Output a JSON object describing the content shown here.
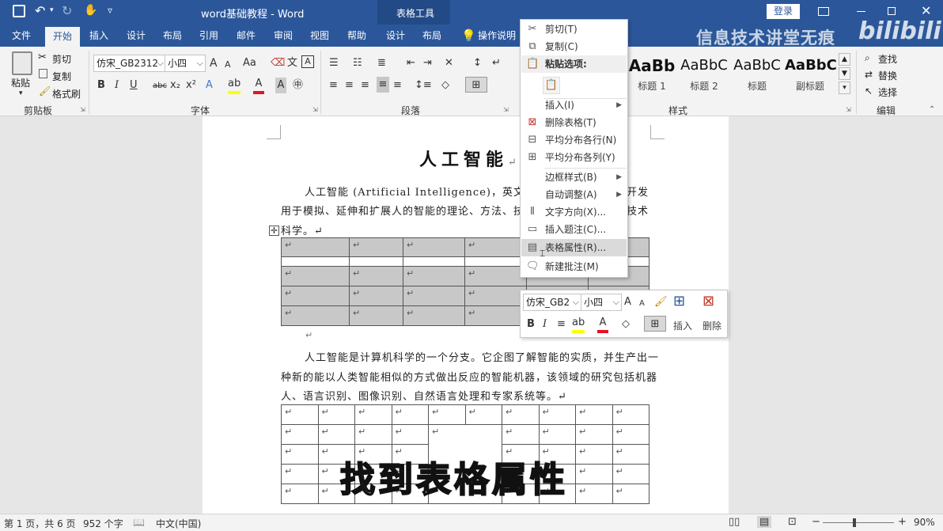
{
  "window": {
    "title": "word基础教程 - Word",
    "context_tools": "表格工具",
    "login": "登录",
    "quick_access_arrow": "▿"
  },
  "tabs": {
    "file": "文件",
    "home": "开始",
    "insert": "插入",
    "design": "设计",
    "layout": "布局",
    "references": "引用",
    "mailings": "邮件",
    "review": "审阅",
    "view": "视图",
    "help": "帮助",
    "table_design": "设计",
    "table_layout": "布局",
    "tell_me": "操作说明搜"
  },
  "clipboard": {
    "paste": "粘贴",
    "cut": "剪切",
    "copy": "复制",
    "format_painter": "格式刷",
    "group": "剪贴板"
  },
  "font": {
    "name": "仿宋_GB2312",
    "size": "小四",
    "group": "字体",
    "bold": "B",
    "italic": "I",
    "underline": "U",
    "strike": "abc",
    "sub": "x₂",
    "sup": "x²",
    "aa": "Aa",
    "grow": "A",
    "shrink": "A"
  },
  "paragraph": {
    "group": "段落"
  },
  "styles": {
    "group": "样式",
    "items": [
      {
        "preview": "AaBb",
        "name": "标题 1"
      },
      {
        "preview": "AaBbC",
        "name": "标题 2"
      },
      {
        "preview": "AaBbC",
        "name": "标题"
      },
      {
        "preview": "AaBbC",
        "name": "副标题"
      }
    ]
  },
  "editing": {
    "find": "查找",
    "replace": "替换",
    "select": "选择",
    "group": "编辑"
  },
  "watermark": {
    "channel": "信息技术讲堂无痕",
    "logo": "bilibili"
  },
  "document": {
    "title": "人工智能",
    "para1_line1": "人工智能 (Artificial Intelligence)，英文",
    "para1_line1_end": "开发",
    "para1_line2": "用于模拟、延伸和扩展人的智能的理论、方法、技术",
    "para1_line2_end": "技术",
    "para1_line3": "科学。↵",
    "para2_line1": "人工智能是计算机科学的一个分支。它企图了解智能的实质，并生产出一",
    "para2_line2": "种新的能以人类智能相似的方式做出反应的智能机器，该领域的研究包括机器",
    "para2_line3": "人、语言识别、图像识别、自然语言处理和专家系统等。↵",
    "cell_mark": "↵",
    "paragraph_mark": "↵"
  },
  "context_menu": {
    "cut": "剪切(T)",
    "copy": "复制(C)",
    "paste_options": "粘贴选项:",
    "insert": "插入(I)",
    "delete_table": "删除表格(T)",
    "distribute_rows": "平均分布各行(N)",
    "distribute_cols": "平均分布各列(Y)",
    "borders": "边框样式(B)",
    "autofit": "自动调整(A)",
    "text_direction": "文字方向(X)...",
    "insert_caption": "插入题注(C)...",
    "table_properties": "表格属性(R)...",
    "new_comment": "新建批注(M)"
  },
  "mini_toolbar": {
    "font": "仿宋_GB2",
    "size": "小四",
    "insert": "插入",
    "delete": "删除",
    "bold": "B",
    "italic": "I"
  },
  "caption": "找到表格属性",
  "status": {
    "page": "第 1 页，共 6 页",
    "words": "952 个字",
    "language": "中文(中国)",
    "zoom": "90%",
    "zoom_fraction": 0.9,
    "minus": "−",
    "plus": "+"
  },
  "colors": {
    "word_blue": "#2b579a",
    "context_band": "#224a87",
    "highlight_yellow": "#ffff00",
    "font_red": "#e81123"
  }
}
